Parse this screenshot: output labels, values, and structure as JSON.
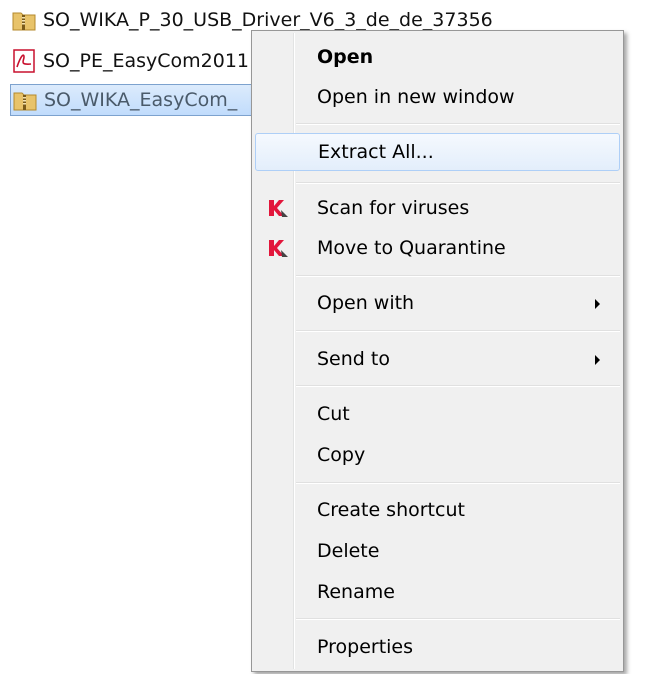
{
  "files": [
    {
      "name": "SO_WIKA_P_30_USB_Driver_V6_3_de_de_37356",
      "icon": "zip-folder-icon",
      "selected": false
    },
    {
      "name": "SO_PE_EasyCom2011",
      "icon": "pdf-icon",
      "selected": false
    },
    {
      "name": "SO_WIKA_EasyCom_",
      "icon": "zip-folder-icon",
      "selected": true
    }
  ],
  "context_menu": {
    "open": "Open",
    "open_new_window": "Open in new window",
    "extract_all": "Extract All...",
    "scan_viruses": "Scan for viruses",
    "move_quarantine": "Move to Quarantine",
    "open_with": "Open with",
    "send_to": "Send to",
    "cut": "Cut",
    "copy": "Copy",
    "create_shortcut": "Create shortcut",
    "delete": "Delete",
    "rename": "Rename",
    "properties": "Properties"
  },
  "colors": {
    "selection_border": "#7da2ce",
    "hover_border": "#aecff7",
    "menu_background": "#f0f0f0",
    "kaspersky_red": "#e2163b"
  }
}
